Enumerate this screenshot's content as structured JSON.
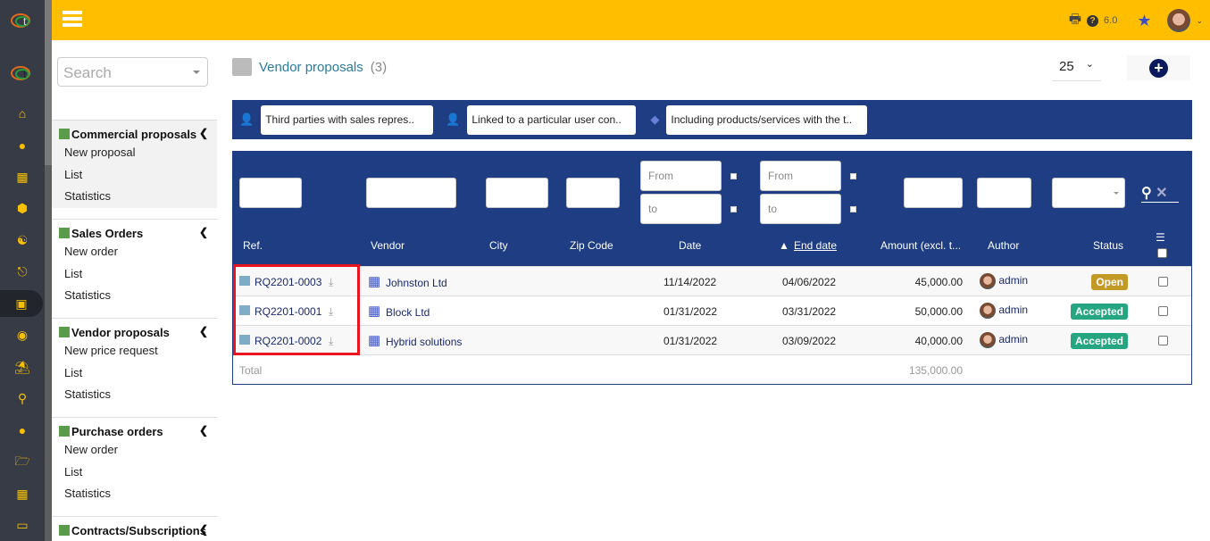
{
  "header": {
    "version": "6.0",
    "icons": [
      "menu-icon",
      "print-icon",
      "help-icon",
      "star-icon",
      "user-avatar"
    ]
  },
  "rail": {
    "icons": [
      "home-icon",
      "user-icon",
      "building-icon",
      "box-icon",
      "cubes-icon",
      "sitemap-icon",
      "briefcase-icon",
      "coins-icon",
      "bank-icon",
      "search-dollar-icon",
      "user-tie-icon",
      "folder-open-icon",
      "calendar-icon",
      "ticket-icon"
    ],
    "active": "briefcase-icon",
    "accent": "#f8c000"
  },
  "sidebar": {
    "search_placeholder": "Search",
    "sections": [
      {
        "title": "Commercial proposals",
        "items": [
          "New proposal",
          "List",
          "Statistics"
        ]
      },
      {
        "title": "Sales Orders",
        "items": [
          "New order",
          "List",
          "Statistics"
        ]
      },
      {
        "title": "Vendor proposals",
        "items": [
          "New price request",
          "List",
          "Statistics"
        ]
      },
      {
        "title": "Purchase orders",
        "items": [
          "New order",
          "List",
          "Statistics"
        ]
      },
      {
        "title": "Contracts/Subscriptions",
        "items": []
      }
    ]
  },
  "page": {
    "title": "Vendor proposals",
    "count": "(3)",
    "limit": "25"
  },
  "filters": [
    "Third parties with sales repres..",
    "Linked to a particular user con..",
    "Including products/services with the t.."
  ],
  "search_fields": {
    "from": "From",
    "to": "to"
  },
  "columns": [
    "Ref.",
    "Vendor",
    "City",
    "Zip Code",
    "Date",
    "End date",
    "Amount (excl. t...",
    "Author",
    "Status"
  ],
  "rows": [
    {
      "ref": "RQ2201-0003",
      "vendor": "Johnston Ltd",
      "city": "",
      "zip": "",
      "date": "11/14/2022",
      "end_date": "04/06/2022",
      "amount": "45,000.00",
      "author": "admin",
      "status": "Open",
      "status_color": "#c49a27"
    },
    {
      "ref": "RQ2201-0001",
      "vendor": "Block Ltd",
      "city": "",
      "zip": "",
      "date": "01/31/2022",
      "end_date": "03/31/2022",
      "amount": "50,000.00",
      "author": "admin",
      "status": "Accepted",
      "status_color": "#25a580"
    },
    {
      "ref": "RQ2201-0002",
      "vendor": "Hybrid solutions",
      "city": "",
      "zip": "",
      "date": "01/31/2022",
      "end_date": "03/09/2022",
      "amount": "40,000.00",
      "author": "admin",
      "status": "Accepted",
      "status_color": "#25a580"
    }
  ],
  "total": {
    "label": "Total",
    "amount": "135,000.00"
  },
  "colors": {
    "header": "#ffbf00",
    "table_header": "#1e3d83",
    "highlight": "#e8141e"
  }
}
